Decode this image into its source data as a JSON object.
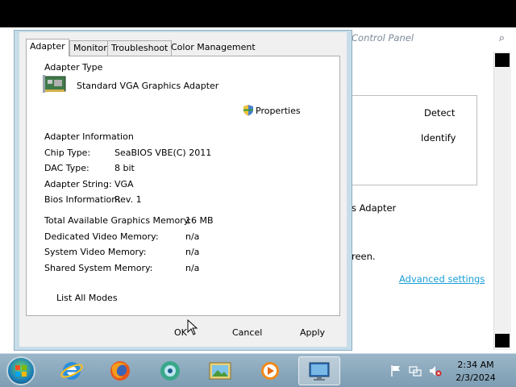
{
  "background_window": {
    "search_placeholder": "Control Panel",
    "detect_label": "Detect",
    "identify_label": "Identify",
    "adapter_fragment": "s Adapter",
    "screen_fragment": "reen.",
    "advanced_settings_label": "Advanced settings"
  },
  "dialog": {
    "tabs": [
      {
        "label": "Adapter"
      },
      {
        "label": "Monitor"
      },
      {
        "label": "Troubleshoot"
      },
      {
        "label": "Color Management"
      }
    ],
    "adapter_type_heading": "Adapter Type",
    "adapter_name": "Standard VGA Graphics Adapter",
    "properties_label": "Properties",
    "adapter_info_heading": "Adapter Information",
    "info": [
      {
        "label": "Chip Type:",
        "value": "SeaBIOS VBE(C) 2011"
      },
      {
        "label": "DAC Type:",
        "value": "8 bit"
      },
      {
        "label": "Adapter String:",
        "value": "VGA"
      },
      {
        "label": "Bios Information:",
        "value": "Rev. 1"
      }
    ],
    "memory": [
      {
        "label": "Total Available Graphics Memory:",
        "value": "16 MB"
      },
      {
        "label": "Dedicated Video Memory:",
        "value": "n/a"
      },
      {
        "label": "System Video Memory:",
        "value": "n/a"
      },
      {
        "label": "Shared System Memory:",
        "value": "n/a"
      }
    ],
    "list_all_modes_label": "List All Modes",
    "ok_label": "OK",
    "cancel_label": "Cancel",
    "apply_label": "Apply"
  },
  "taskbar": {
    "apps": [
      {
        "icon": "internet-explorer-icon"
      },
      {
        "icon": "firefox-icon"
      },
      {
        "icon": "media-center-icon"
      },
      {
        "icon": "photo-viewer-icon"
      },
      {
        "icon": "media-player-icon"
      },
      {
        "icon": "display-settings-icon"
      }
    ],
    "time": "2:34 AM",
    "date": "2/3/2024"
  }
}
